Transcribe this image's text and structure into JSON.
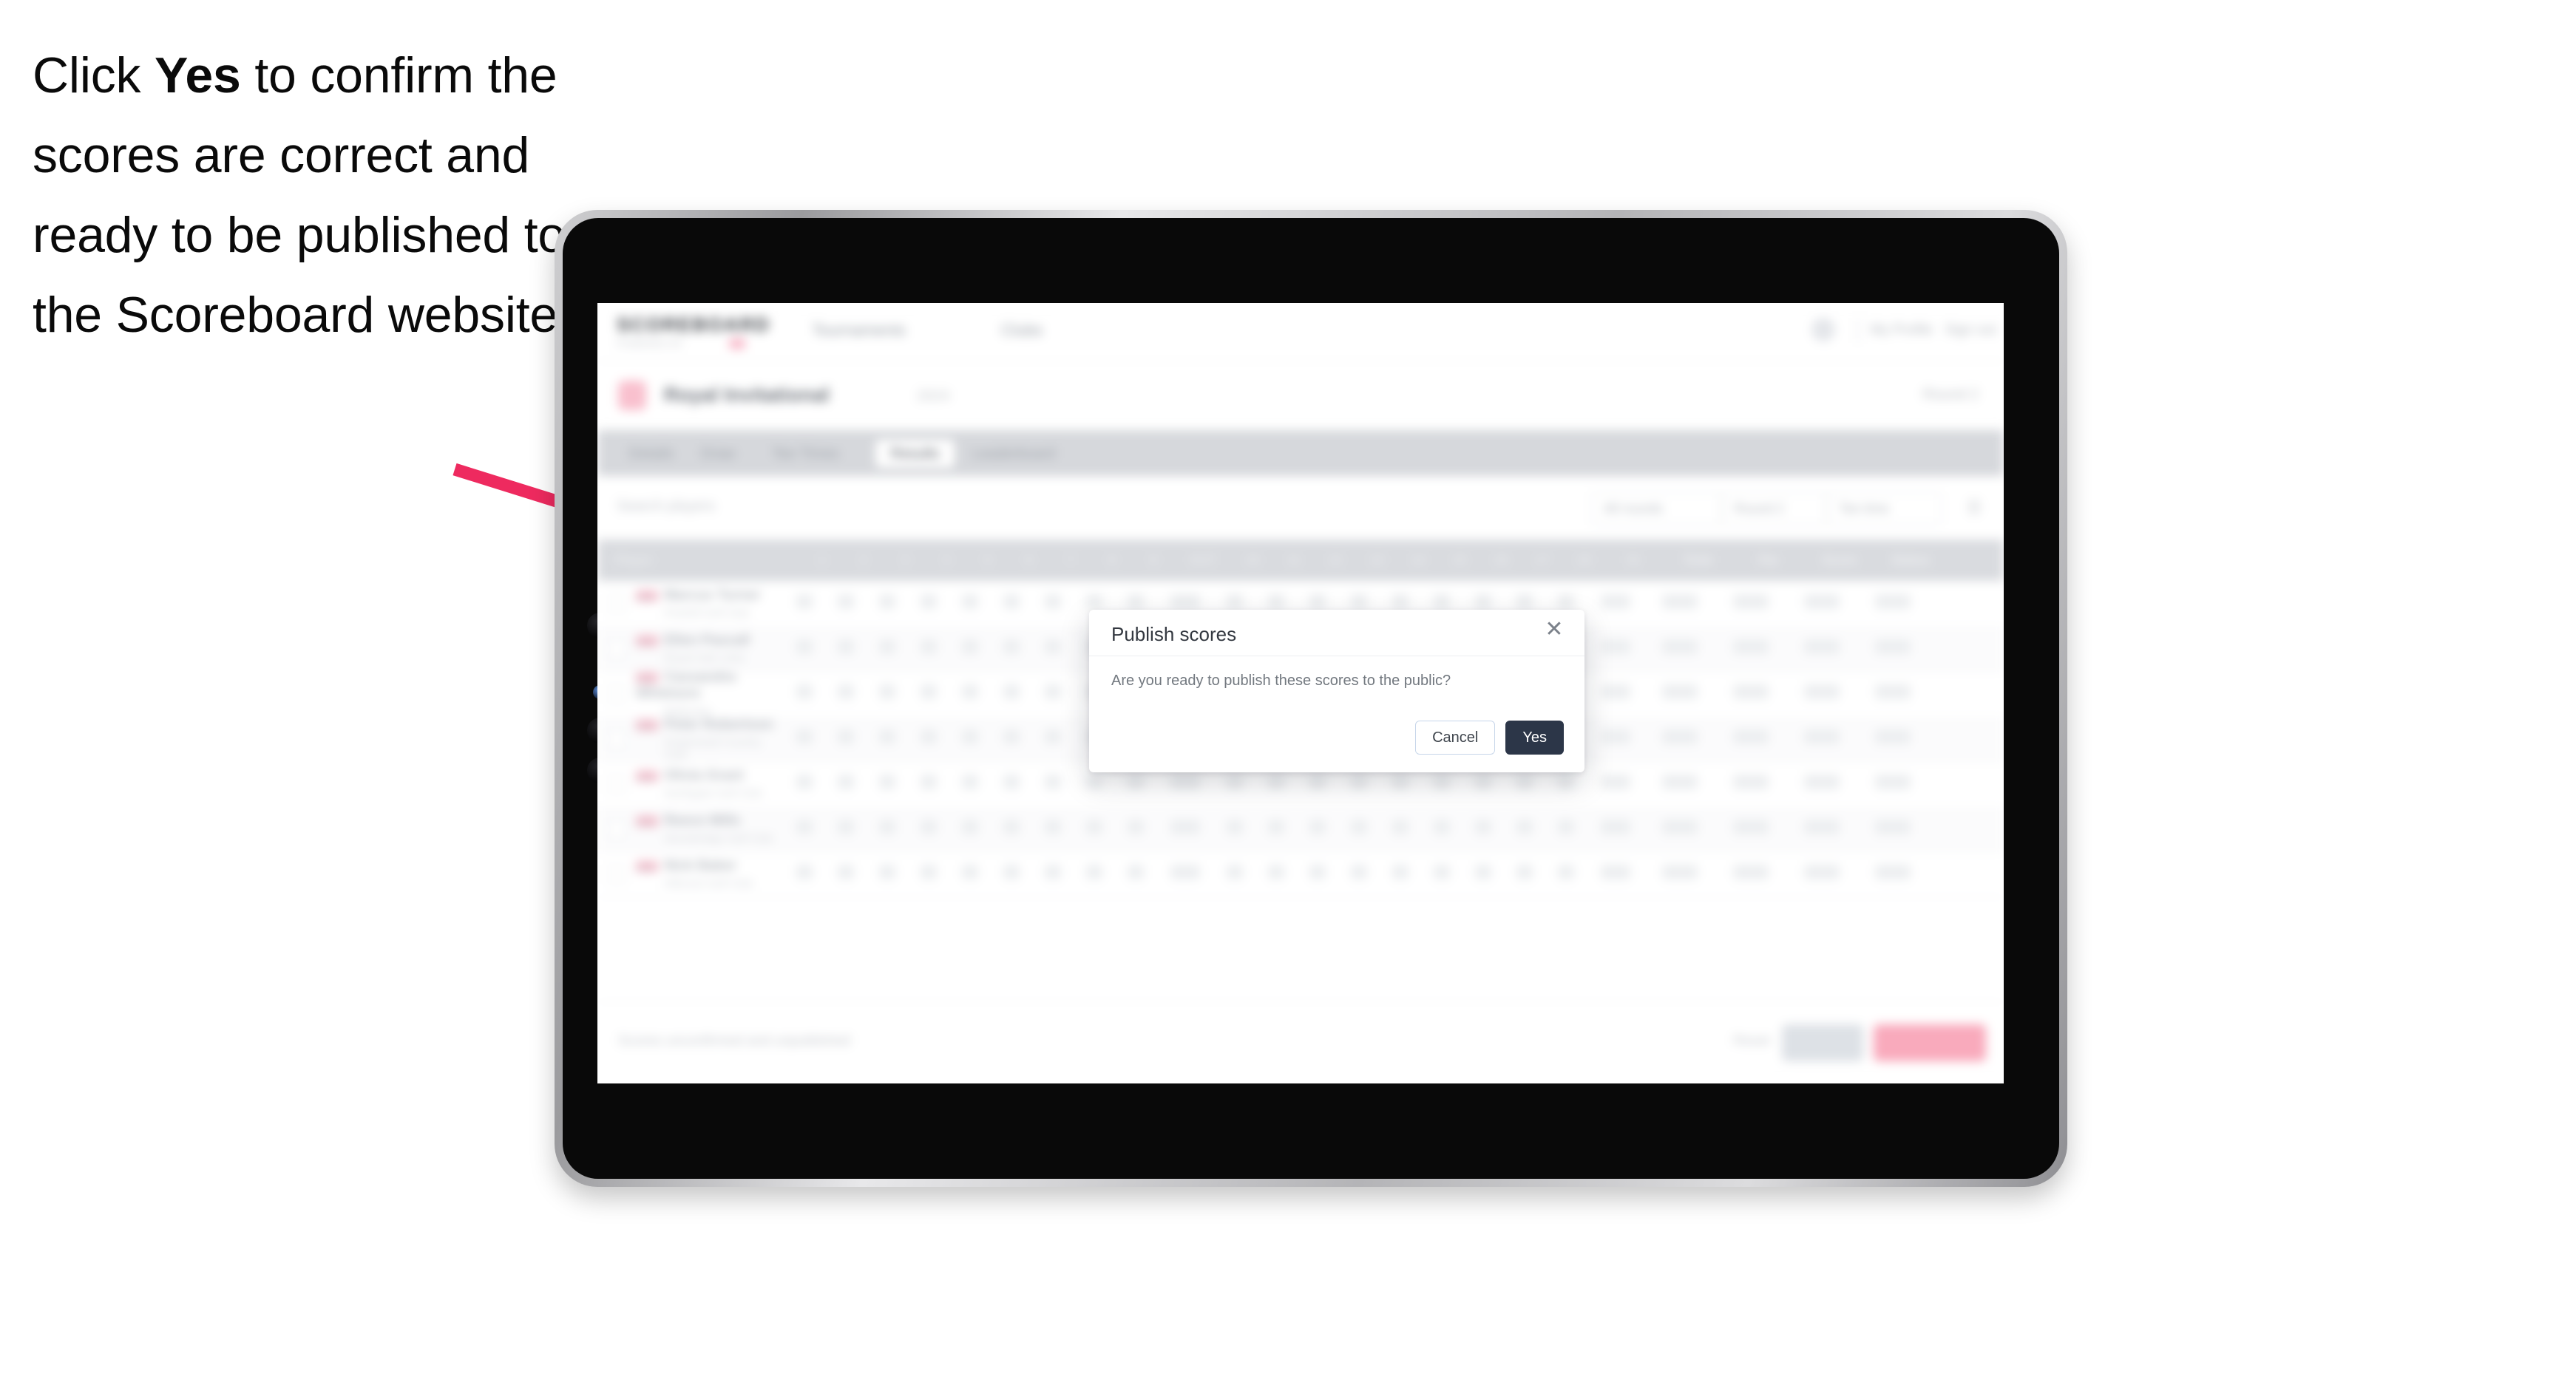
{
  "instruction": {
    "before": "Click ",
    "emphasis": "Yes",
    "after": " to confirm the scores are correct and ready to be published to the Scoreboard website."
  },
  "annotation": {
    "arrow_color": "#ee2a5f",
    "arrow_name": "pointer-arrow"
  },
  "device": {
    "name": "tablet",
    "bezel_color": "#c2c2c5",
    "screen_color": "#090909"
  },
  "app": {
    "blurred": true,
    "nav": {
      "logo": "SCOREBOARD",
      "logo_sub": "POWERED BY",
      "items": [
        "Tournaments",
        "Clubs"
      ],
      "user": "My Profile",
      "signout": "Sign out"
    },
    "page": {
      "title": "Royal Invitational",
      "meta": "2024",
      "right_meta": "Round 2"
    },
    "tabs": [
      {
        "label": "Details",
        "active": false
      },
      {
        "label": "Draw",
        "active": false
      },
      {
        "label": "Tee Times",
        "active": false
      },
      {
        "label": "Results",
        "active": true
      },
      {
        "label": "Leaderboard",
        "active": false
      }
    ],
    "filters": {
      "left_label": "Search players",
      "controls": [
        "All rounds",
        "Round 2",
        "Tee time"
      ],
      "icon": "filter-icon"
    },
    "table": {
      "header": {
        "player": "Player",
        "holes": [
          "1",
          "2",
          "3",
          "4",
          "5",
          "6",
          "7",
          "8",
          "9",
          "OUT",
          "10",
          "11",
          "12",
          "13",
          "14",
          "15",
          "16",
          "17",
          "18",
          "IN"
        ],
        "end": [
          "Total",
          "Par",
          "Score",
          "Status"
        ]
      },
      "rows": [
        {
          "badge": "AM",
          "name": "Marcus Turner",
          "club": "Pinehill Golf Club"
        },
        {
          "badge": "AM",
          "name": "Ellen Pascall",
          "club": "Royal Oak Links"
        },
        {
          "badge": "AM",
          "name": "Cassandra Whitmore",
          "club": "Belleview"
        },
        {
          "badge": "AM",
          "name": "Peter Robertson",
          "club": "Kingsmead Country Club"
        },
        {
          "badge": "AM",
          "name": "Olivia Grant",
          "club": "Northgate Golf Club"
        },
        {
          "badge": "AM",
          "name": "Reece Mills",
          "club": "Stonebridge Golf Club"
        },
        {
          "badge": "AM",
          "name": "Nick Baker",
          "club": "Hillcrest Golf Club"
        }
      ]
    },
    "footer": {
      "note": "Scores unconfirmed and unpublished",
      "link": "Reset",
      "secondary_button": "Save",
      "primary_button": "Confirm and publish"
    }
  },
  "modal": {
    "title": "Publish scores",
    "close_icon": "close-icon",
    "body": "Are you ready to publish these scores to the public?",
    "cancel_label": "Cancel",
    "confirm_label": "Yes",
    "confirm_bg": "#2c3648"
  }
}
